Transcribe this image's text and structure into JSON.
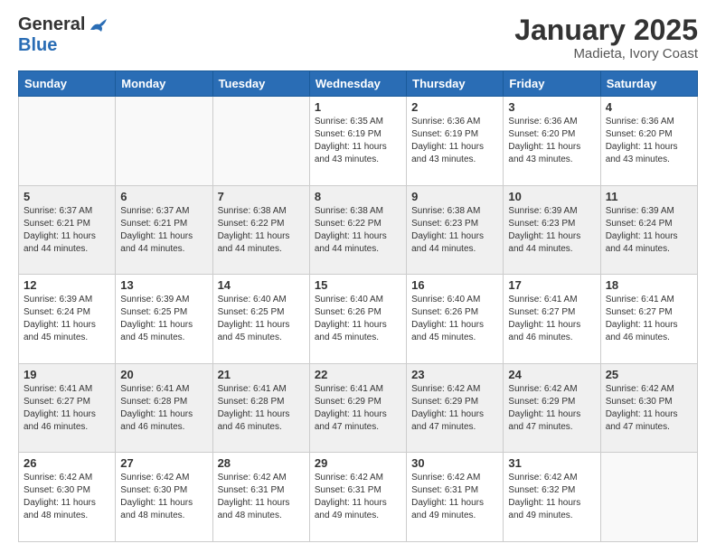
{
  "header": {
    "logo_general": "General",
    "logo_blue": "Blue",
    "month_title": "January 2025",
    "subtitle": "Madieta, Ivory Coast"
  },
  "days_of_week": [
    "Sunday",
    "Monday",
    "Tuesday",
    "Wednesday",
    "Thursday",
    "Friday",
    "Saturday"
  ],
  "weeks": [
    [
      {
        "day": "",
        "info": ""
      },
      {
        "day": "",
        "info": ""
      },
      {
        "day": "",
        "info": ""
      },
      {
        "day": "1",
        "info": "Sunrise: 6:35 AM\nSunset: 6:19 PM\nDaylight: 11 hours\nand 43 minutes."
      },
      {
        "day": "2",
        "info": "Sunrise: 6:36 AM\nSunset: 6:19 PM\nDaylight: 11 hours\nand 43 minutes."
      },
      {
        "day": "3",
        "info": "Sunrise: 6:36 AM\nSunset: 6:20 PM\nDaylight: 11 hours\nand 43 minutes."
      },
      {
        "day": "4",
        "info": "Sunrise: 6:36 AM\nSunset: 6:20 PM\nDaylight: 11 hours\nand 43 minutes."
      }
    ],
    [
      {
        "day": "5",
        "info": "Sunrise: 6:37 AM\nSunset: 6:21 PM\nDaylight: 11 hours\nand 44 minutes."
      },
      {
        "day": "6",
        "info": "Sunrise: 6:37 AM\nSunset: 6:21 PM\nDaylight: 11 hours\nand 44 minutes."
      },
      {
        "day": "7",
        "info": "Sunrise: 6:38 AM\nSunset: 6:22 PM\nDaylight: 11 hours\nand 44 minutes."
      },
      {
        "day": "8",
        "info": "Sunrise: 6:38 AM\nSunset: 6:22 PM\nDaylight: 11 hours\nand 44 minutes."
      },
      {
        "day": "9",
        "info": "Sunrise: 6:38 AM\nSunset: 6:23 PM\nDaylight: 11 hours\nand 44 minutes."
      },
      {
        "day": "10",
        "info": "Sunrise: 6:39 AM\nSunset: 6:23 PM\nDaylight: 11 hours\nand 44 minutes."
      },
      {
        "day": "11",
        "info": "Sunrise: 6:39 AM\nSunset: 6:24 PM\nDaylight: 11 hours\nand 44 minutes."
      }
    ],
    [
      {
        "day": "12",
        "info": "Sunrise: 6:39 AM\nSunset: 6:24 PM\nDaylight: 11 hours\nand 45 minutes."
      },
      {
        "day": "13",
        "info": "Sunrise: 6:39 AM\nSunset: 6:25 PM\nDaylight: 11 hours\nand 45 minutes."
      },
      {
        "day": "14",
        "info": "Sunrise: 6:40 AM\nSunset: 6:25 PM\nDaylight: 11 hours\nand 45 minutes."
      },
      {
        "day": "15",
        "info": "Sunrise: 6:40 AM\nSunset: 6:26 PM\nDaylight: 11 hours\nand 45 minutes."
      },
      {
        "day": "16",
        "info": "Sunrise: 6:40 AM\nSunset: 6:26 PM\nDaylight: 11 hours\nand 45 minutes."
      },
      {
        "day": "17",
        "info": "Sunrise: 6:41 AM\nSunset: 6:27 PM\nDaylight: 11 hours\nand 46 minutes."
      },
      {
        "day": "18",
        "info": "Sunrise: 6:41 AM\nSunset: 6:27 PM\nDaylight: 11 hours\nand 46 minutes."
      }
    ],
    [
      {
        "day": "19",
        "info": "Sunrise: 6:41 AM\nSunset: 6:27 PM\nDaylight: 11 hours\nand 46 minutes."
      },
      {
        "day": "20",
        "info": "Sunrise: 6:41 AM\nSunset: 6:28 PM\nDaylight: 11 hours\nand 46 minutes."
      },
      {
        "day": "21",
        "info": "Sunrise: 6:41 AM\nSunset: 6:28 PM\nDaylight: 11 hours\nand 46 minutes."
      },
      {
        "day": "22",
        "info": "Sunrise: 6:41 AM\nSunset: 6:29 PM\nDaylight: 11 hours\nand 47 minutes."
      },
      {
        "day": "23",
        "info": "Sunrise: 6:42 AM\nSunset: 6:29 PM\nDaylight: 11 hours\nand 47 minutes."
      },
      {
        "day": "24",
        "info": "Sunrise: 6:42 AM\nSunset: 6:29 PM\nDaylight: 11 hours\nand 47 minutes."
      },
      {
        "day": "25",
        "info": "Sunrise: 6:42 AM\nSunset: 6:30 PM\nDaylight: 11 hours\nand 47 minutes."
      }
    ],
    [
      {
        "day": "26",
        "info": "Sunrise: 6:42 AM\nSunset: 6:30 PM\nDaylight: 11 hours\nand 48 minutes."
      },
      {
        "day": "27",
        "info": "Sunrise: 6:42 AM\nSunset: 6:30 PM\nDaylight: 11 hours\nand 48 minutes."
      },
      {
        "day": "28",
        "info": "Sunrise: 6:42 AM\nSunset: 6:31 PM\nDaylight: 11 hours\nand 48 minutes."
      },
      {
        "day": "29",
        "info": "Sunrise: 6:42 AM\nSunset: 6:31 PM\nDaylight: 11 hours\nand 49 minutes."
      },
      {
        "day": "30",
        "info": "Sunrise: 6:42 AM\nSunset: 6:31 PM\nDaylight: 11 hours\nand 49 minutes."
      },
      {
        "day": "31",
        "info": "Sunrise: 6:42 AM\nSunset: 6:32 PM\nDaylight: 11 hours\nand 49 minutes."
      },
      {
        "day": "",
        "info": ""
      }
    ]
  ]
}
